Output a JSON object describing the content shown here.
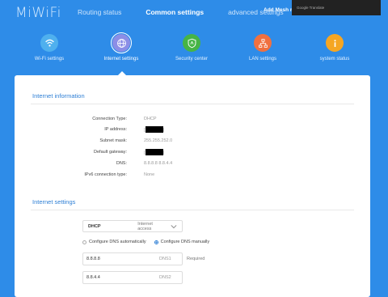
{
  "header": {
    "logo": "MiWiFi",
    "nav": [
      {
        "label": "Routing status",
        "active": false
      },
      {
        "label": "Common settings",
        "active": true
      },
      {
        "label": "advanced settings",
        "active": false
      }
    ],
    "mesh_label": "Add Mesh no",
    "overlay_text": "Google Translate"
  },
  "tiles": [
    {
      "label": "Wi-Fi settings",
      "icon": "wifi-icon",
      "color": "#4fb0ee",
      "active": false
    },
    {
      "label": "Internet settings",
      "icon": "globe-icon",
      "color": "#8c8ee6",
      "active": true
    },
    {
      "label": "Security center",
      "icon": "shield-icon",
      "color": "#46b446",
      "active": false
    },
    {
      "label": "LAN settings",
      "icon": "network-icon",
      "color": "#f07040",
      "active": false
    },
    {
      "label": "system status",
      "icon": "info-icon",
      "color": "#f5a623",
      "active": false
    }
  ],
  "internet_info": {
    "title": "Internet information",
    "rows": [
      {
        "label": "Connection Type:",
        "value": "DHCP"
      },
      {
        "label": "IP address:",
        "value": "",
        "redacted": true
      },
      {
        "label": "Subnet mask:",
        "value": "255.255.252.0"
      },
      {
        "label": "Default gateway:",
        "value": "",
        "redacted": true
      },
      {
        "label": "DNS:",
        "value": "8.8.8.8 8.8.4.4"
      },
      {
        "label": "IPv6 connection type:",
        "value": "None"
      }
    ]
  },
  "internet_settings": {
    "title": "Internet settings",
    "mode": {
      "value": "DHCP",
      "hint": "Internet access"
    },
    "dns_auto_label": "Configure DNS automatically",
    "dns_manual_label": "Configure DNS manually",
    "dns_manual_selected": true,
    "dns1": {
      "value": "8.8.8.8",
      "tag": "DNS1"
    },
    "dns2": {
      "value": "8.8.4.4",
      "tag": "DNS2"
    },
    "required_label": "Required"
  },
  "colors": {
    "background": "#2e8ce8",
    "accent": "#2e7fd5"
  }
}
